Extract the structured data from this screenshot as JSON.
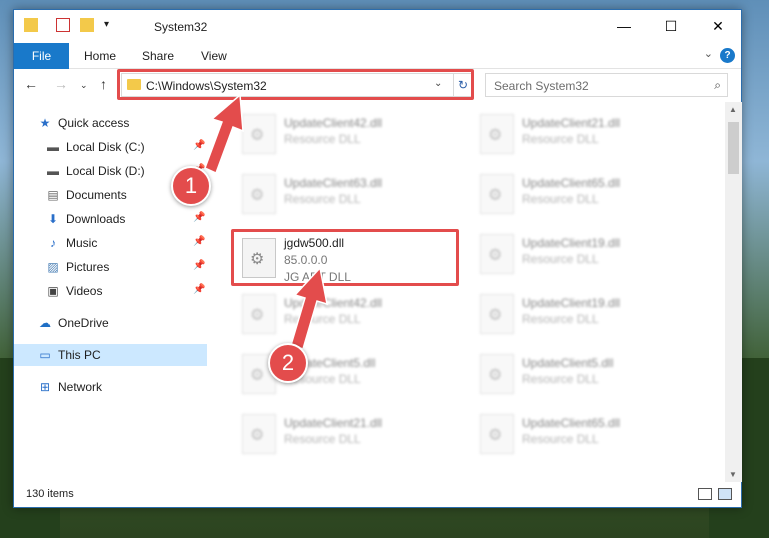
{
  "window": {
    "title": "System32",
    "controls": {
      "minimize": "—",
      "maximize": "☐",
      "close": "✕"
    }
  },
  "ribbon": {
    "file_tab": "File",
    "tabs": [
      "Home",
      "Share",
      "View"
    ]
  },
  "address": {
    "path": "C:\\Windows\\System32",
    "search_placeholder": "Search System32"
  },
  "sidebar": {
    "items": [
      {
        "label": "Quick access",
        "icon": "star-icon",
        "pinned": false
      },
      {
        "label": "Local Disk (C:)",
        "icon": "drive-icon",
        "pinned": true
      },
      {
        "label": "Local Disk (D:)",
        "icon": "drive-icon",
        "pinned": true
      },
      {
        "label": "Documents",
        "icon": "document-icon",
        "pinned": true
      },
      {
        "label": "Downloads",
        "icon": "download-icon",
        "pinned": true
      },
      {
        "label": "Music",
        "icon": "music-icon",
        "pinned": true
      },
      {
        "label": "Pictures",
        "icon": "pictures-icon",
        "pinned": true
      },
      {
        "label": "Videos",
        "icon": "video-icon",
        "pinned": true
      },
      {
        "label": "OneDrive",
        "icon": "cloud-icon",
        "pinned": false
      },
      {
        "label": "This PC",
        "icon": "computer-icon",
        "pinned": false
      },
      {
        "label": "Network",
        "icon": "network-icon",
        "pinned": false
      }
    ]
  },
  "files": [
    {
      "name": "UpdateClient42.dll",
      "type": "Resource DLL",
      "blurred": true
    },
    {
      "name": "UpdateClient21.dll",
      "type": "Resource DLL",
      "blurred": true
    },
    {
      "name": "UpdateClient63.dll",
      "type": "Resource DLL",
      "blurred": true
    },
    {
      "name": "UpdateClient65.dll",
      "type": "Resource DLL",
      "blurred": true
    },
    {
      "name": "jgdw500.dll",
      "version": "85.0.0.0",
      "type": "JG ART DLL",
      "blurred": false
    },
    {
      "name": "UpdateClient19.dll",
      "type": "Resource DLL",
      "blurred": true
    },
    {
      "name": "UpdateClient42.dll",
      "type": "Resource DLL",
      "blurred": true
    },
    {
      "name": "UpdateClient19.dll",
      "type": "Resource DLL",
      "blurred": true
    },
    {
      "name": "UpdateClient5.dll",
      "type": "Resource DLL",
      "blurred": true
    },
    {
      "name": "UpdateClient5.dll",
      "type": "Resource DLL",
      "blurred": true
    },
    {
      "name": "UpdateClient21.dll",
      "type": "Resource DLL",
      "blurred": true
    },
    {
      "name": "UpdateClient65.dll",
      "type": "Resource DLL",
      "blurred": true
    }
  ],
  "status": {
    "item_count": "130 items"
  },
  "annotations": {
    "step1": "1",
    "step2": "2",
    "color": "#e34c4c"
  }
}
